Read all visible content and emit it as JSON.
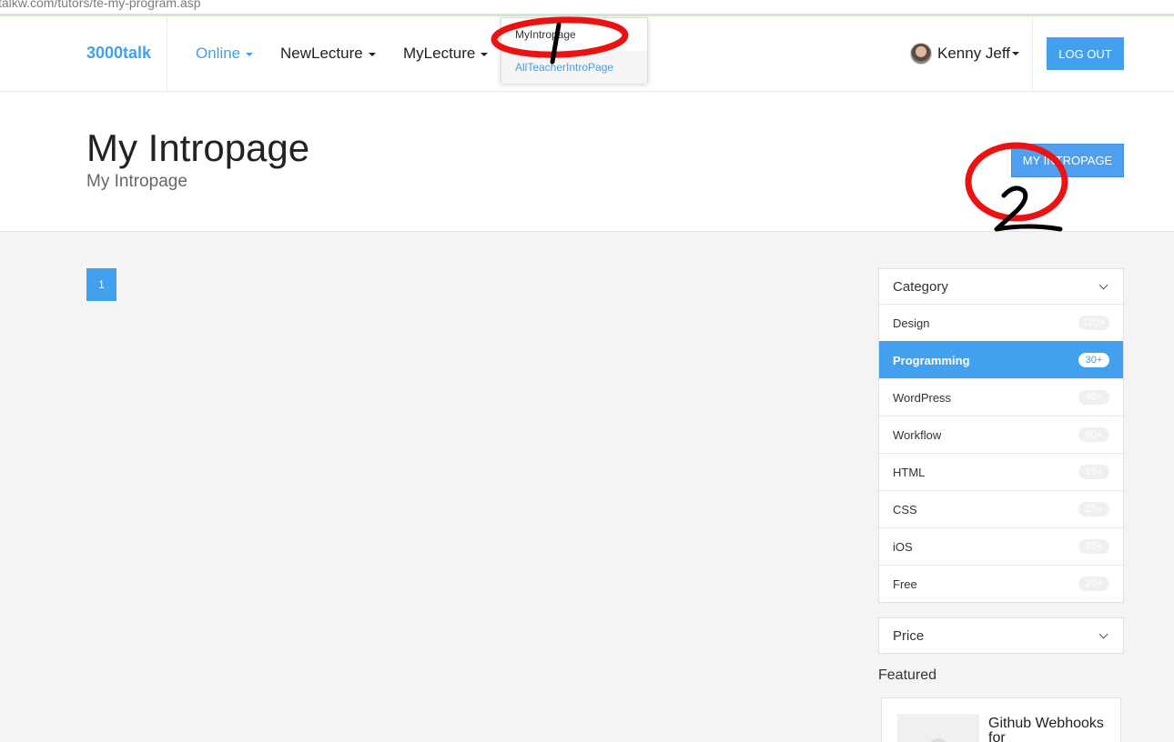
{
  "address_bar": {
    "url_fragment": "talkw.com/tutors/te-my-program.asp"
  },
  "navbar": {
    "brand": "3000talk",
    "menu": [
      {
        "label": "Online",
        "active": true
      },
      {
        "label": "NewLecture",
        "active": false
      },
      {
        "label": "MyLecture",
        "active": false
      }
    ],
    "dropdown": [
      "MyIntropage",
      "AllTeacherIntroPage"
    ],
    "user_name": "Kenny Jeff",
    "logout_label": "LOG OUT"
  },
  "header": {
    "title": "My Intropage",
    "subtitle": "My Intropage",
    "button_label": "MY INTROPAGE"
  },
  "pagination": {
    "current_page": "1"
  },
  "sidebar": {
    "category_title": "Category",
    "categories": [
      {
        "label": "Design",
        "count": "120+",
        "active": false
      },
      {
        "label": "Programming",
        "count": "30+",
        "active": true
      },
      {
        "label": "WordPress",
        "count": "40+",
        "active": false
      },
      {
        "label": "Workflow",
        "count": "60+",
        "active": false
      },
      {
        "label": "HTML",
        "count": "15+",
        "active": false
      },
      {
        "label": "CSS",
        "count": "25+",
        "active": false
      },
      {
        "label": "iOS",
        "count": "35+",
        "active": false
      },
      {
        "label": "Free",
        "count": "20+",
        "active": false
      }
    ],
    "price_title": "Price",
    "featured_title": "Featured",
    "featured_item": "Github Webhooks for"
  },
  "annotations": {
    "marker_1": "1",
    "marker_2": "2",
    "circle_color": "#ee1111",
    "ink_color": "#000000"
  },
  "colors": {
    "accent": "#42a0ef",
    "background": "#f4f4f4"
  }
}
